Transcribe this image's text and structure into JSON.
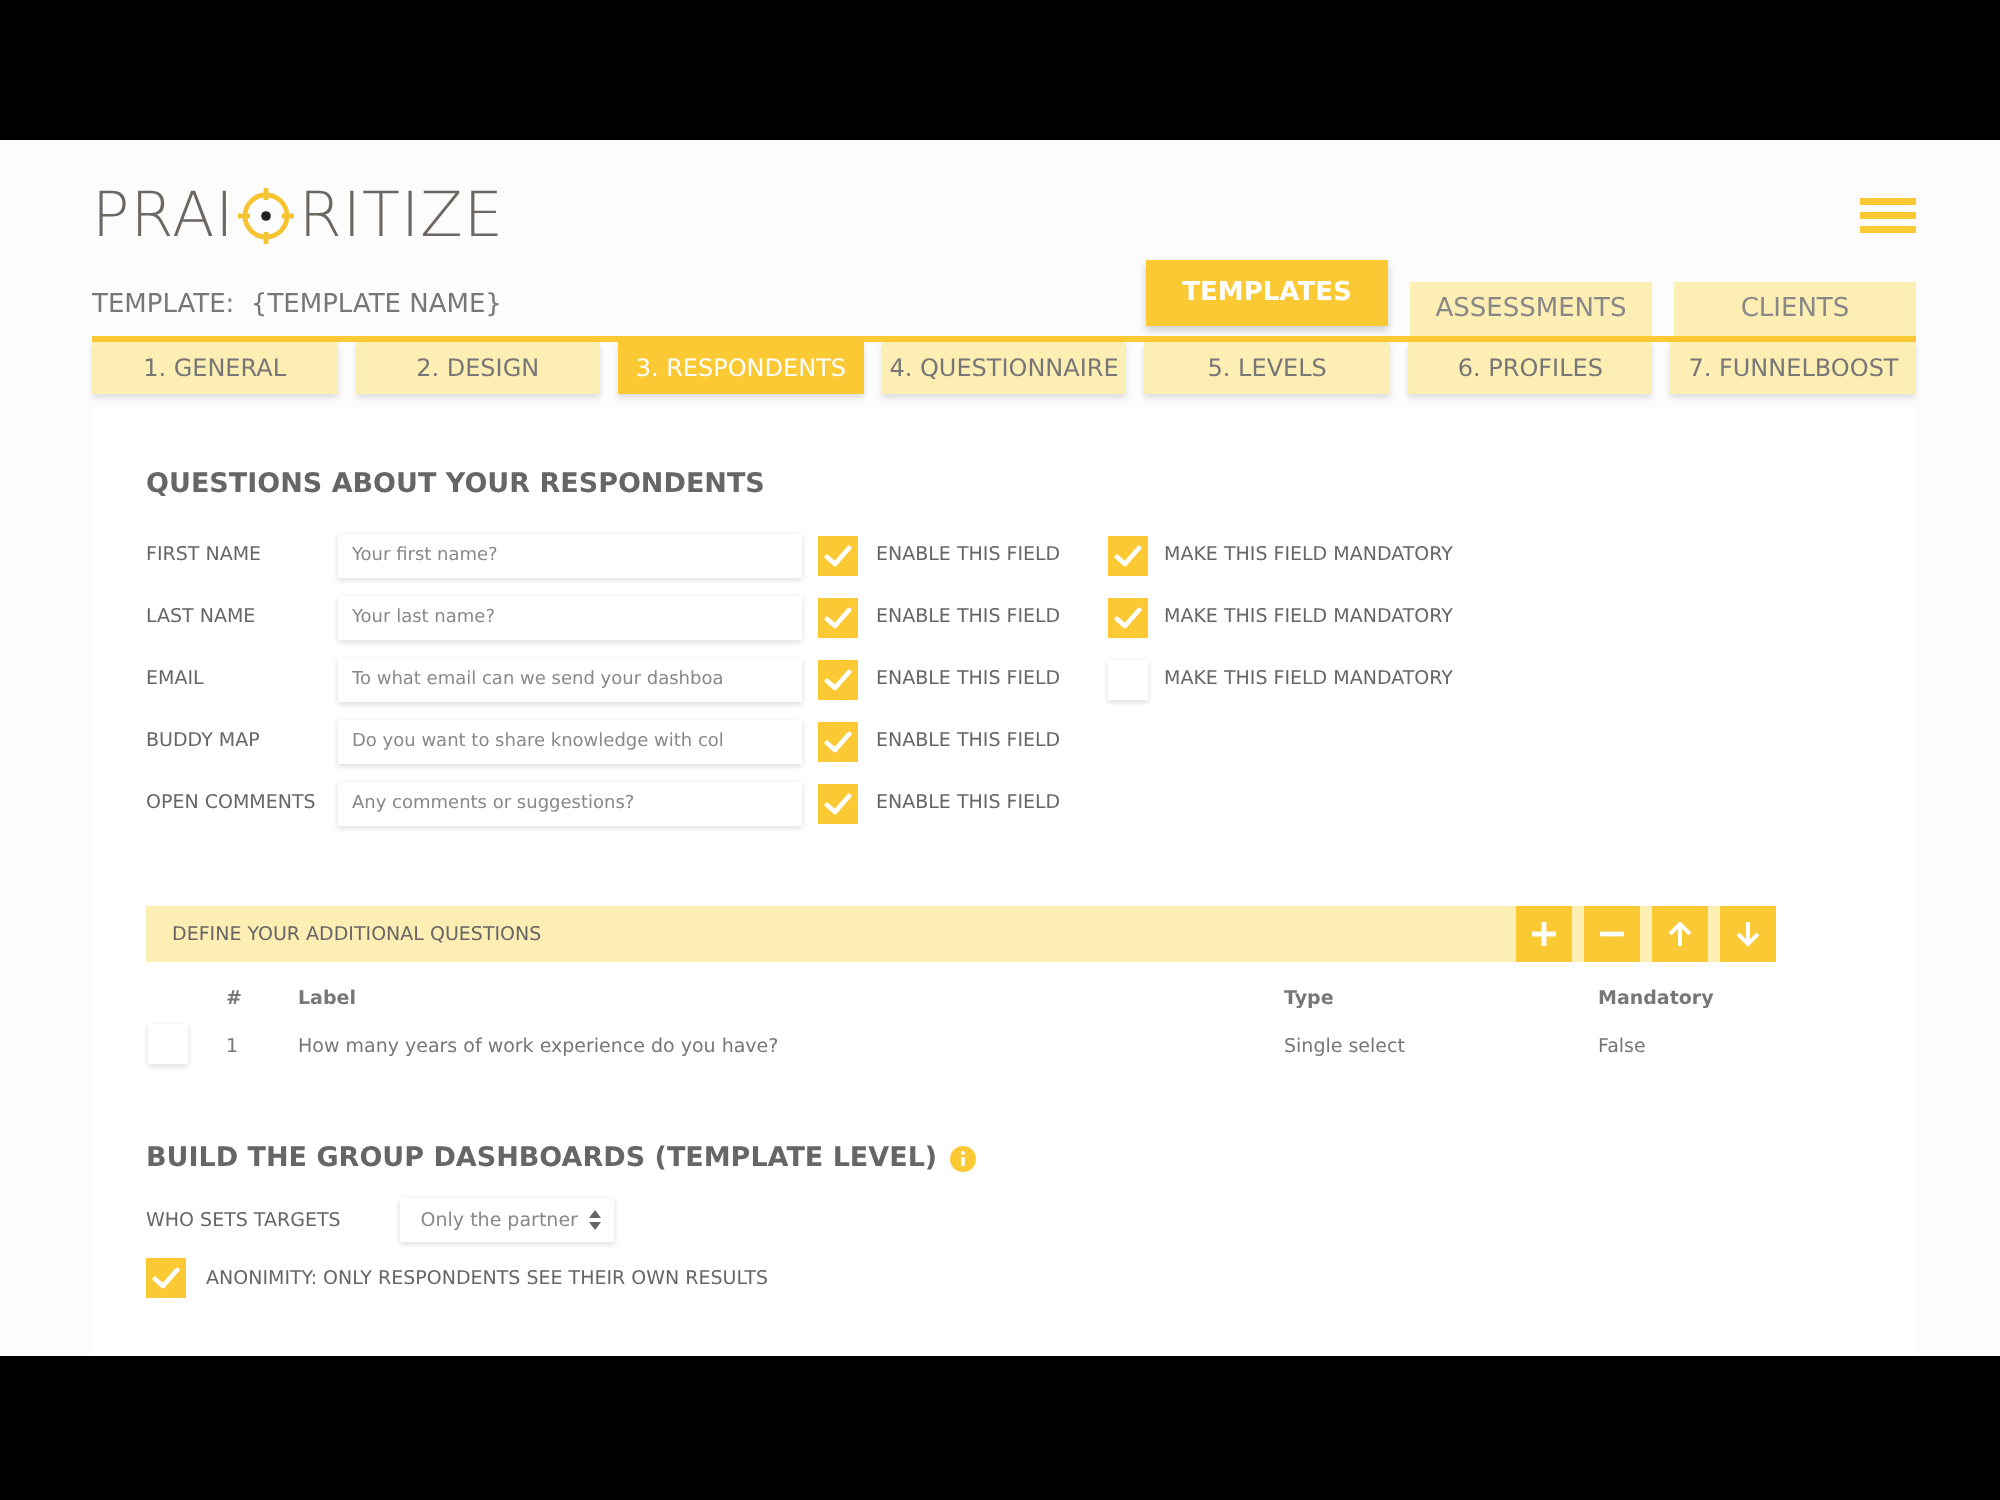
{
  "logo": {
    "before": "PRAI",
    "after": "RITIZE"
  },
  "template_label": "TEMPLATE:  {TEMPLATE NAME}",
  "main_nav": [
    {
      "label": "TEMPLATES",
      "selected": true
    },
    {
      "label": "ASSESSMENTS",
      "selected": false
    },
    {
      "label": "CLIENTS",
      "selected": false
    }
  ],
  "steps": [
    {
      "label": "1. GENERAL",
      "selected": false
    },
    {
      "label": "2. DESIGN",
      "selected": false
    },
    {
      "label": "3. RESPONDENTS",
      "selected": true
    },
    {
      "label": "4. QUESTIONNAIRE",
      "selected": false
    },
    {
      "label": "5. LEVELS",
      "selected": false
    },
    {
      "label": "6. PROFILES",
      "selected": false
    },
    {
      "label": "7. FUNNELBOOST",
      "selected": false
    }
  ],
  "respondents": {
    "title": "QUESTIONS ABOUT YOUR RESPONDENTS",
    "fields": [
      {
        "label": "FIRST NAME",
        "placeholder": "Your first name?",
        "enabled": true,
        "enable_label": "ENABLE THIS FIELD",
        "mandatory": true,
        "mandatory_label": "MAKE THIS FIELD MANDATORY"
      },
      {
        "label": "LAST NAME",
        "placeholder": "Your last name?",
        "enabled": true,
        "enable_label": "ENABLE THIS FIELD",
        "mandatory": true,
        "mandatory_label": "MAKE THIS FIELD MANDATORY"
      },
      {
        "label": "EMAIL",
        "placeholder": "To what email can we send your dashboa",
        "enabled": true,
        "enable_label": "ENABLE THIS FIELD",
        "mandatory": false,
        "mandatory_label": "MAKE THIS FIELD MANDATORY"
      },
      {
        "label": "BUDDY MAP",
        "placeholder": "Do you want to share knowledge with col",
        "enabled": true,
        "enable_label": "ENABLE THIS FIELD"
      },
      {
        "label": "OPEN COMMENTS",
        "placeholder": "Any comments or suggestions?",
        "enabled": true,
        "enable_label": "ENABLE THIS FIELD"
      }
    ]
  },
  "additional_questions": {
    "title": "DEFINE YOUR ADDITIONAL QUESTIONS",
    "columns": [
      "#",
      "Label",
      "Type",
      "Mandatory"
    ],
    "rows": [
      {
        "checked": false,
        "cells": [
          "1",
          "How many years of work experience do you have?",
          "Single select",
          "False"
        ]
      }
    ]
  },
  "dashboards": {
    "title": "BUILD THE GROUP DASHBOARDS (TEMPLATE LEVEL)",
    "targets_label": "WHO SETS TARGETS",
    "targets_value": "Only the partner",
    "anonimity": {
      "checked": true,
      "label": "ANONIMITY: ONLY RESPONDENTS SEE THEIR OWN RESULTS"
    }
  }
}
